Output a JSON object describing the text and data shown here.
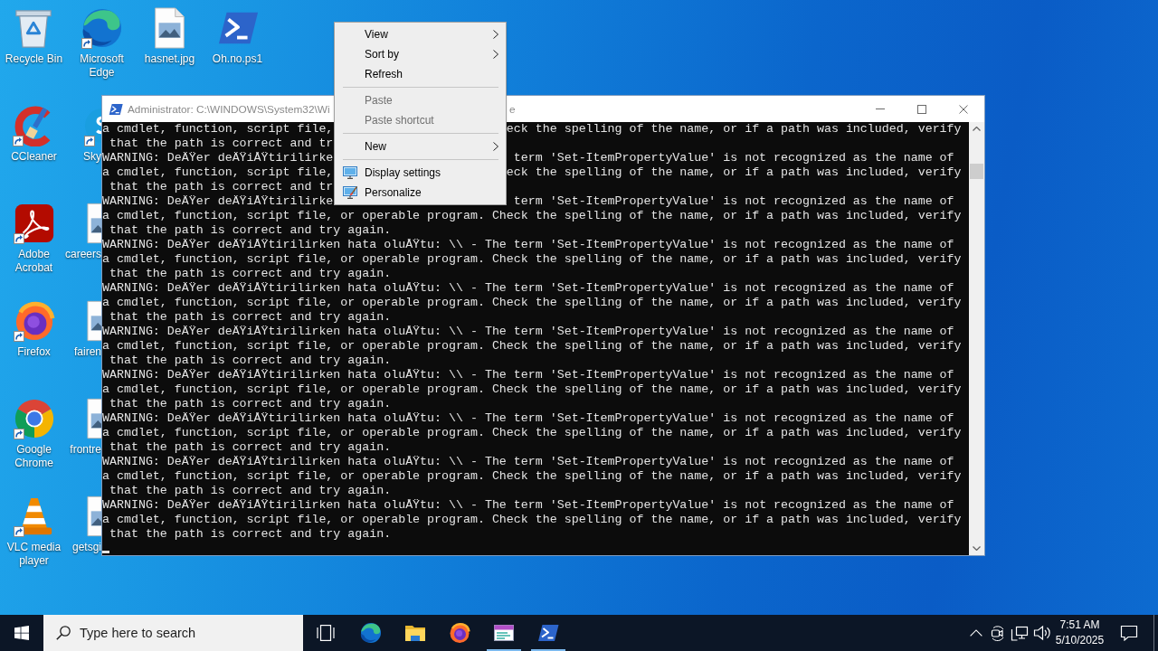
{
  "desktop_columns": [
    {
      "icons": [
        {
          "label": "Recycle Bin",
          "kind": "full",
          "shortcut": false
        },
        {
          "label": "CCleaner",
          "kind": "full",
          "shortcut": true
        },
        {
          "label": "Adobe Acrobat",
          "kind": "full",
          "shortcut": true
        },
        {
          "label": "Firefox",
          "kind": "full",
          "shortcut": true
        },
        {
          "label": "Google Chrome",
          "kind": "full",
          "shortcut": true
        },
        {
          "label": "VLC media player",
          "kind": "full",
          "shortcut": true
        }
      ]
    },
    {
      "icons": [
        {
          "label": "Microsoft Edge",
          "kind": "full",
          "shortcut": true
        },
        {
          "label": "Sky",
          "kind": "clipped",
          "shortcut": true
        },
        {
          "label": "careers",
          "kind": "clipped",
          "shortcut": false
        },
        {
          "label": "fairen",
          "kind": "clipped",
          "shortcut": false
        },
        {
          "label": "frontre",
          "kind": "clipped",
          "shortcut": false
        },
        {
          "label": "getsgi",
          "kind": "clipped",
          "shortcut": false
        }
      ]
    },
    {
      "icons": [
        {
          "label": "hasnet.jpg",
          "kind": "full",
          "shortcut": false
        }
      ]
    },
    {
      "icons": [
        {
          "label": "Oh.no.ps1",
          "kind": "full",
          "shortcut": false
        }
      ]
    }
  ],
  "console_window": {
    "title": "Administrator: C:\\WINDOWS\\System32\\Wi",
    "title_tail": "e",
    "lines": [
      {
        "kind": "split",
        "left": "a cmdlet, function, script file,",
        "right": "eck the spelling of the name, or if a path was included, verify"
      },
      {
        "kind": "split",
        "left": " that the path is correct and tr"
      },
      {
        "kind": "split",
        "left": "WARNING: DeÄŸer deÄŸiÅŸtirilirke",
        "right": " term 'Set-ItemPropertyValue' is not recognized as the name of"
      },
      {
        "kind": "split",
        "left": "a cmdlet, function, script file,",
        "right": "eck the spelling of the name, or if a path was included, verify"
      },
      {
        "kind": "split",
        "left": " that the path is correct and tr"
      },
      {
        "kind": "split",
        "left": "WARNING: DeÄŸer deÄŸiÅŸtirilirke",
        "right": " term 'Set-ItemPropertyValue' is not recognized as the name of"
      },
      {
        "kind": "full",
        "text": "a cmdlet, function, script file, or operable program. Check the spelling of the name, or if a path was included, verify"
      },
      {
        "kind": "full",
        "text": " that the path is correct and try again."
      },
      {
        "kind": "full",
        "text": "WARNING: DeÄŸer deÄŸiÅŸtirilirken hata oluÅŸtu: \\\\ - The term 'Set-ItemPropertyValue' is not recognized as the name of"
      },
      {
        "kind": "full",
        "text": "a cmdlet, function, script file, or operable program. Check the spelling of the name, or if a path was included, verify"
      },
      {
        "kind": "full",
        "text": " that the path is correct and try again."
      },
      {
        "kind": "full",
        "text": "WARNING: DeÄŸer deÄŸiÅŸtirilirken hata oluÅŸtu: \\\\ - The term 'Set-ItemPropertyValue' is not recognized as the name of"
      },
      {
        "kind": "full",
        "text": "a cmdlet, function, script file, or operable program. Check the spelling of the name, or if a path was included, verify"
      },
      {
        "kind": "full",
        "text": " that the path is correct and try again."
      },
      {
        "kind": "full",
        "text": "WARNING: DeÄŸer deÄŸiÅŸtirilirken hata oluÅŸtu: \\\\ - The term 'Set-ItemPropertyValue' is not recognized as the name of"
      },
      {
        "kind": "full",
        "text": "a cmdlet, function, script file, or operable program. Check the spelling of the name, or if a path was included, verify"
      },
      {
        "kind": "full",
        "text": " that the path is correct and try again."
      },
      {
        "kind": "full",
        "text": "WARNING: DeÄŸer deÄŸiÅŸtirilirken hata oluÅŸtu: \\\\ - The term 'Set-ItemPropertyValue' is not recognized as the name of"
      },
      {
        "kind": "full",
        "text": "a cmdlet, function, script file, or operable program. Check the spelling of the name, or if a path was included, verify"
      },
      {
        "kind": "full",
        "text": " that the path is correct and try again."
      },
      {
        "kind": "full",
        "text": "WARNING: DeÄŸer deÄŸiÅŸtirilirken hata oluÅŸtu: \\\\ - The term 'Set-ItemPropertyValue' is not recognized as the name of"
      },
      {
        "kind": "full",
        "text": "a cmdlet, function, script file, or operable program. Check the spelling of the name, or if a path was included, verify"
      },
      {
        "kind": "full",
        "text": " that the path is correct and try again."
      },
      {
        "kind": "full",
        "text": "WARNING: DeÄŸer deÄŸiÅŸtirilirken hata oluÅŸtu: \\\\ - The term 'Set-ItemPropertyValue' is not recognized as the name of"
      },
      {
        "kind": "full",
        "text": "a cmdlet, function, script file, or operable program. Check the spelling of the name, or if a path was included, verify"
      },
      {
        "kind": "full",
        "text": " that the path is correct and try again."
      },
      {
        "kind": "full",
        "text": "WARNING: DeÄŸer deÄŸiÅŸtirilirken hata oluÅŸtu: \\\\ - The term 'Set-ItemPropertyValue' is not recognized as the name of"
      },
      {
        "kind": "full",
        "text": "a cmdlet, function, script file, or operable program. Check the spelling of the name, or if a path was included, verify"
      },
      {
        "kind": "full",
        "text": " that the path is correct and try again."
      }
    ]
  },
  "context_menu": {
    "groups": [
      {
        "items": [
          {
            "label": "View",
            "kind": "plain",
            "submenu": true,
            "disabled": false
          },
          {
            "label": "Sort by",
            "kind": "plain",
            "submenu": true,
            "disabled": false
          },
          {
            "label": "Refresh",
            "kind": "plain",
            "submenu": false,
            "disabled": false
          }
        ]
      },
      {
        "items": [
          {
            "label": "Paste",
            "kind": "plain",
            "submenu": false,
            "disabled": true
          },
          {
            "label": "Paste shortcut",
            "kind": "plain",
            "submenu": false,
            "disabled": true
          }
        ]
      },
      {
        "items": [
          {
            "label": "New",
            "kind": "plain",
            "submenu": true,
            "disabled": false
          }
        ]
      },
      {
        "items": [
          {
            "label": "Display settings",
            "kind": "with_icon",
            "submenu": false,
            "disabled": false
          },
          {
            "label": "Personalize",
            "kind": "with_icon",
            "submenu": false,
            "disabled": false
          }
        ]
      }
    ]
  },
  "taskbar": {
    "search": {
      "placeholder": "Type here to search"
    },
    "apps": [
      {
        "running": false
      },
      {
        "running": false
      },
      {
        "running": false
      },
      {
        "running": true
      },
      {
        "running": true
      }
    ],
    "clock": {
      "time": "7:51 AM",
      "date": "5/10/2025"
    }
  }
}
